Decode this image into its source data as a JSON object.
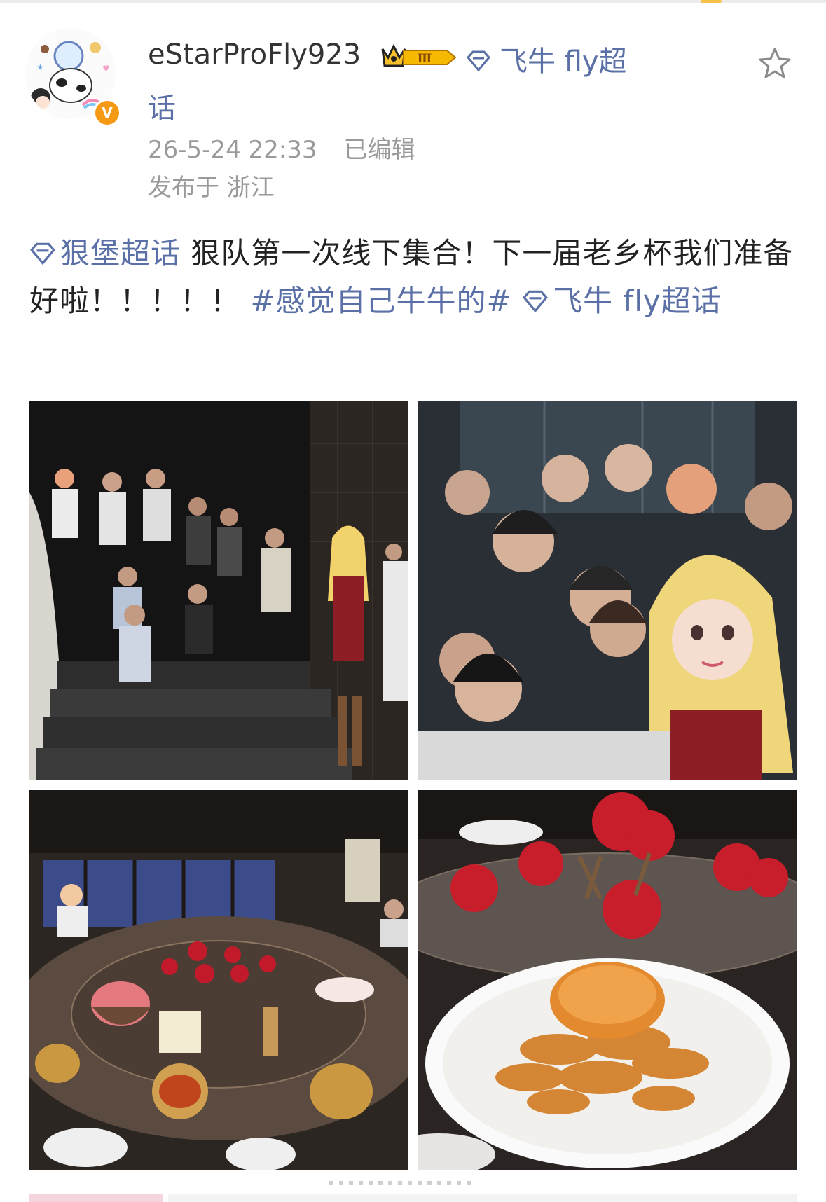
{
  "post": {
    "author": {
      "username": "eStarProFly923",
      "verified_mark": "V",
      "level_badge": "Ⅲ"
    },
    "topic_tag_inline": {
      "line1": "飞牛 fly超",
      "line2": "话"
    },
    "timestamp": "26-5-24 22:33",
    "edited_label": "已编辑",
    "location": "发布于 浙江",
    "text": {
      "topic1": "狠堡超话",
      "body1": " 狠队第一次线下集合！下一届老乡杯我们准备好啦！！！！！ ",
      "hashtag": "#感觉自己牛牛的#",
      "topic2": "飞牛 fly超话"
    },
    "icons": {
      "favorite": "star-outline-icon",
      "supertopic": "diamond-icon",
      "crown": "crown-icon"
    },
    "photos": [
      {
        "name": "group-photo-stairs"
      },
      {
        "name": "group-selfie"
      },
      {
        "name": "banquet-table"
      },
      {
        "name": "crab-dish"
      }
    ]
  },
  "colors": {
    "link": "#5a70a6",
    "meta": "#9a9a9a",
    "verified": "#f59a12"
  }
}
